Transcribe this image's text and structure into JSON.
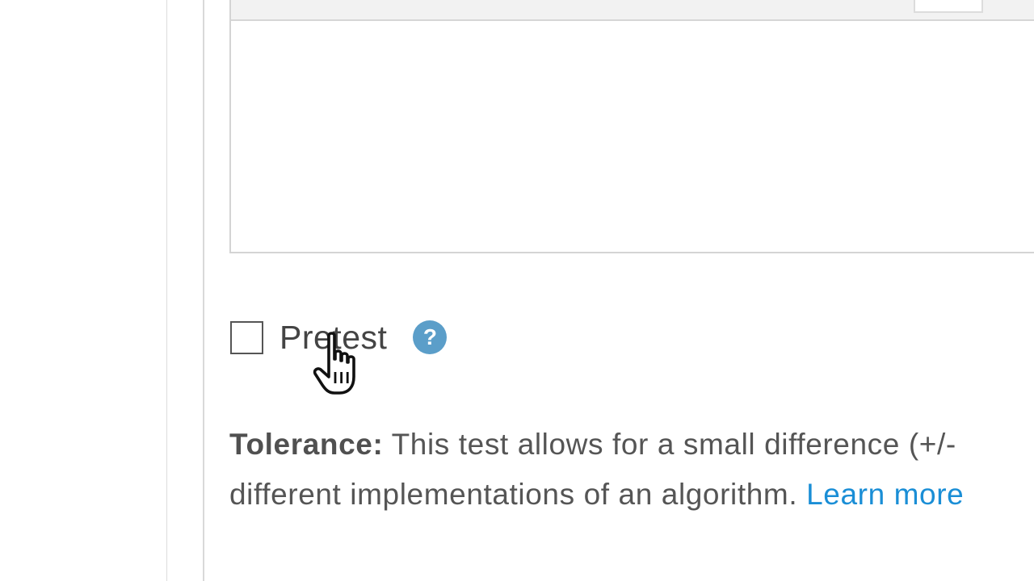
{
  "pretest": {
    "label": "Pretest",
    "checked": false,
    "help_icon": "question-mark-icon",
    "help_glyph": "?"
  },
  "tolerance": {
    "heading": "Tolerance:",
    "text_line1": "This test allows for a small difference (+/-",
    "text_line2": "different implementations of an algorithm.",
    "learn_more": "Learn more"
  },
  "colors": {
    "help_icon": "#5b9ec9",
    "link": "#1a8ed6",
    "text": "#555555"
  },
  "cursor": "hand-pointer-icon"
}
